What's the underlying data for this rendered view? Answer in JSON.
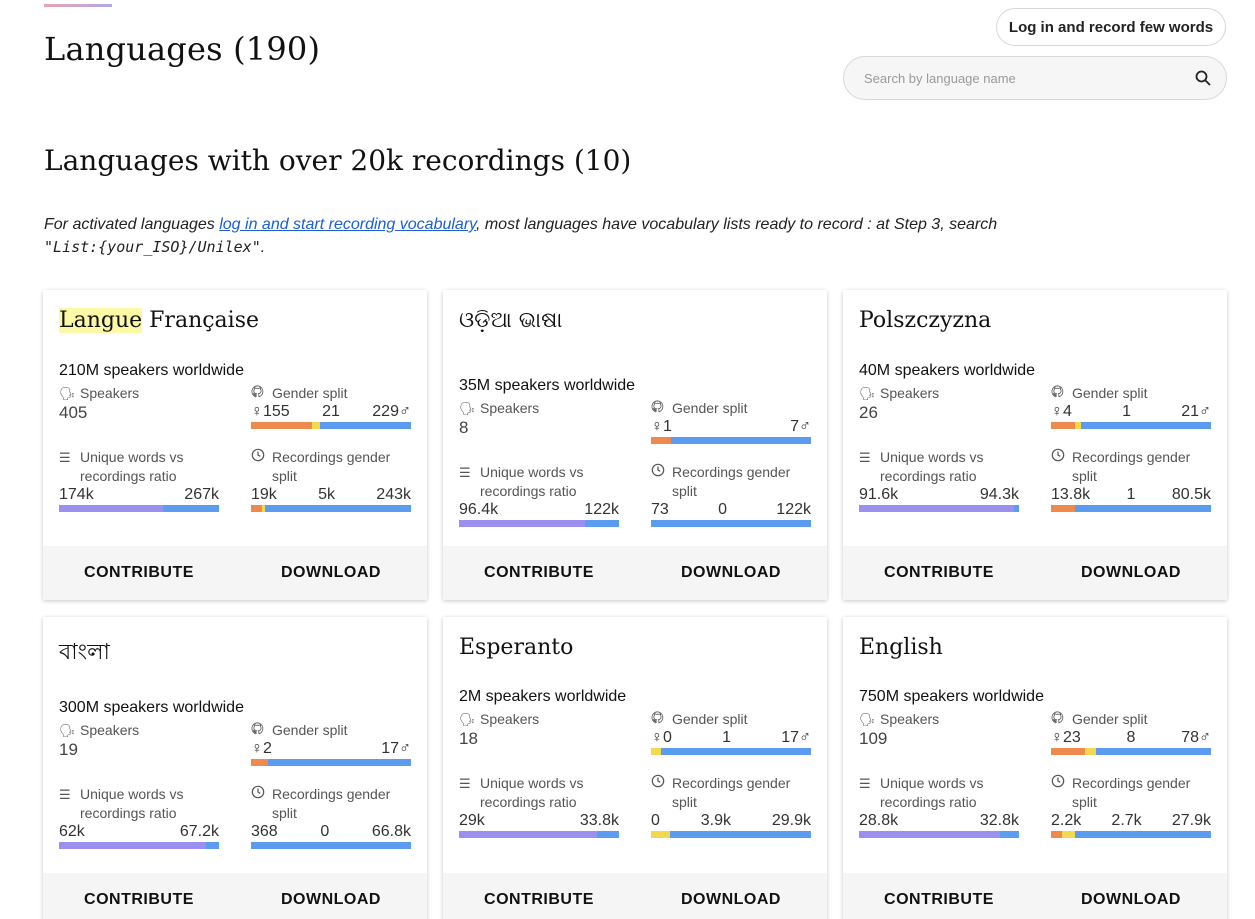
{
  "header": {
    "title": "Languages (190)",
    "login_label": "Log in and record few words",
    "search_placeholder": "Search by language name"
  },
  "section": {
    "title": "Languages with over 20k recordings (10)",
    "intro_before": "For activated languages ",
    "intro_link": "log in and start recording vocabulary",
    "intro_after": ", most languages have vocabulary lists ready to record : at Step 3, search",
    "intro_code": "\"List:{your_ISO}/Unilex\"",
    "intro_end": "."
  },
  "labels": {
    "speakers": "Speakers",
    "gender_split": "Gender split",
    "unique_words": "Unique words vs recordings ratio",
    "recordings_gender": "Recordings gender split",
    "contribute": "CONTRIBUTE",
    "download": "DOWNLOAD"
  },
  "colors": {
    "words": "#9b8ff0",
    "recordings": "#5b9bf0",
    "female": "#ee8a4e",
    "other": "#f2d94e",
    "male": "#5b9bf0"
  },
  "cards": [
    {
      "name_highlight": "Langue",
      "name_rest": " Française",
      "speakers_worldwide": "210M speakers worldwide",
      "speakers": "405",
      "gender": {
        "female": "♀155",
        "other": "21",
        "male": "229♂",
        "female_frac": 0.38,
        "other_frac": 0.05,
        "male_frac": 0.57
      },
      "words": {
        "unique": "174k",
        "recordings": "267k",
        "ratio": 0.65
      },
      "rec_gender": {
        "female": "19k",
        "other": "5k",
        "male": "243k",
        "female_frac": 0.07,
        "other_frac": 0.02,
        "male_frac": 0.91
      }
    },
    {
      "name_highlight": "",
      "name_rest": "ଓଡ଼ିଆ ଭାଷା",
      "speakers_worldwide": "35M speakers worldwide",
      "speakers": "8",
      "gender": {
        "female": "♀1",
        "other": "",
        "male": "7♂",
        "female_frac": 0.125,
        "other_frac": 0,
        "male_frac": 0.875
      },
      "words": {
        "unique": "96.4k",
        "recordings": "122k",
        "ratio": 0.79
      },
      "rec_gender": {
        "female": "73",
        "other": "0",
        "male": "122k",
        "female_frac": 0.0,
        "other_frac": 0,
        "male_frac": 1.0
      }
    },
    {
      "name_highlight": "",
      "name_rest": "Polszczyzna",
      "speakers_worldwide": "40M speakers worldwide",
      "speakers": "26",
      "gender": {
        "female": "♀4",
        "other": "1",
        "male": "21♂",
        "female_frac": 0.15,
        "other_frac": 0.04,
        "male_frac": 0.81
      },
      "words": {
        "unique": "91.6k",
        "recordings": "94.3k",
        "ratio": 0.97
      },
      "rec_gender": {
        "female": "13.8k",
        "other": "1",
        "male": "80.5k",
        "female_frac": 0.15,
        "other_frac": 0,
        "male_frac": 0.85
      }
    },
    {
      "name_highlight": "",
      "name_rest": "বাংলা",
      "speakers_worldwide": "300M speakers worldwide",
      "speakers": "19",
      "gender": {
        "female": "♀2",
        "other": "",
        "male": "17♂",
        "female_frac": 0.105,
        "other_frac": 0,
        "male_frac": 0.895
      },
      "words": {
        "unique": "62k",
        "recordings": "67.2k",
        "ratio": 0.92
      },
      "rec_gender": {
        "female": "368",
        "other": "0",
        "male": "66.8k",
        "female_frac": 0.0,
        "other_frac": 0,
        "male_frac": 1.0
      }
    },
    {
      "name_highlight": "",
      "name_rest": "Esperanto",
      "speakers_worldwide": "2M speakers worldwide",
      "speakers": "18",
      "gender": {
        "female": "♀0",
        "other": "1",
        "male": "17♂",
        "female_frac": 0.0,
        "other_frac": 0.06,
        "male_frac": 0.94
      },
      "words": {
        "unique": "29k",
        "recordings": "33.8k",
        "ratio": 0.86
      },
      "rec_gender": {
        "female": "0",
        "other": "3.9k",
        "male": "29.9k",
        "female_frac": 0.0,
        "other_frac": 0.12,
        "male_frac": 0.88
      }
    },
    {
      "name_highlight": "",
      "name_rest": "English",
      "speakers_worldwide": "750M speakers worldwide",
      "speakers": "109",
      "gender": {
        "female": "♀23",
        "other": "8",
        "male": "78♂",
        "female_frac": 0.21,
        "other_frac": 0.07,
        "male_frac": 0.72
      },
      "words": {
        "unique": "28.8k",
        "recordings": "32.8k",
        "ratio": 0.88
      },
      "rec_gender": {
        "female": "2.2k",
        "other": "2.7k",
        "male": "27.9k",
        "female_frac": 0.07,
        "other_frac": 0.08,
        "male_frac": 0.85
      }
    }
  ]
}
